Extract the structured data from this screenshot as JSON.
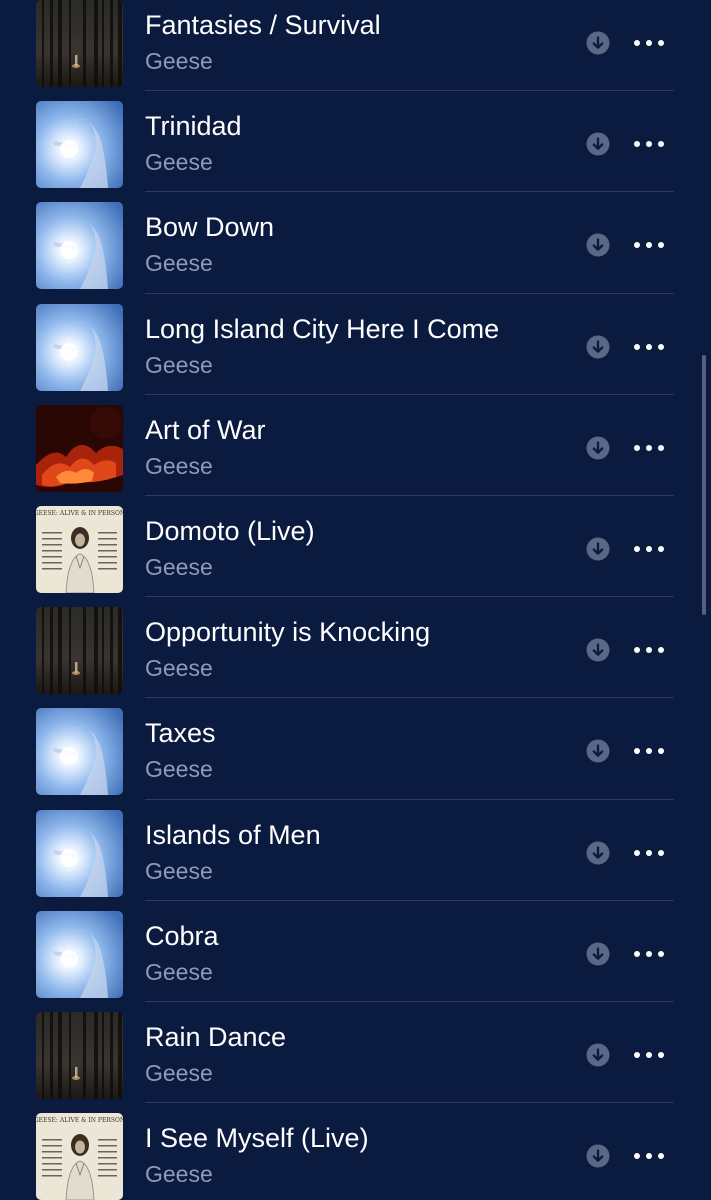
{
  "colors": {
    "background": "#0b1a3f",
    "title": "#ffffff",
    "subtitle": "#8d9bbb",
    "icon": "#5b6786",
    "divider": "#2b3a5e"
  },
  "icons": {
    "download": "arrow-down-circle-icon",
    "more": "ellipsis-icon"
  },
  "songs": [
    {
      "title": "Fantasies / Survival",
      "artist": "Geese",
      "artwork": "forest"
    },
    {
      "title": "Trinidad",
      "artist": "Geese",
      "artwork": "sky"
    },
    {
      "title": "Bow Down",
      "artist": "Geese",
      "artwork": "sky"
    },
    {
      "title": "Long Island City Here I Come",
      "artist": "Geese",
      "artwork": "sky"
    },
    {
      "title": "Art of War",
      "artist": "Geese",
      "artwork": "fire"
    },
    {
      "title": "Domoto (Live)",
      "artist": "Geese",
      "artwork": "live",
      "artwork_text": "GEESE: ALIVE & IN PERSON"
    },
    {
      "title": "Opportunity is Knocking",
      "artist": "Geese",
      "artwork": "forest"
    },
    {
      "title": "Taxes",
      "artist": "Geese",
      "artwork": "sky"
    },
    {
      "title": "Islands of Men",
      "artist": "Geese",
      "artwork": "sky"
    },
    {
      "title": "Cobra",
      "artist": "Geese",
      "artwork": "sky"
    },
    {
      "title": "Rain Dance",
      "artist": "Geese",
      "artwork": "forest"
    },
    {
      "title": "I See Myself (Live)",
      "artist": "Geese",
      "artwork": "live",
      "artwork_text": "GEESE: ALIVE & IN PERSON"
    }
  ]
}
